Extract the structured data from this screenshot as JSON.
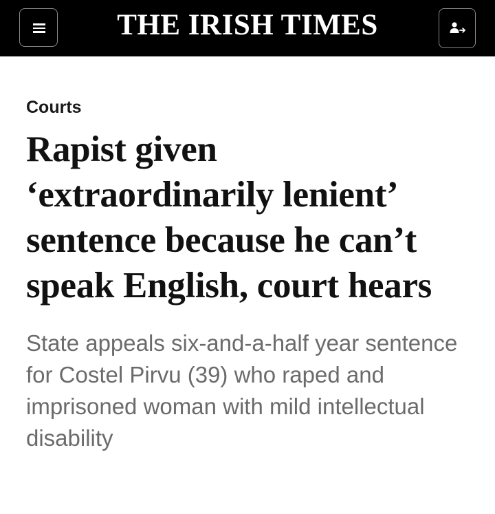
{
  "header": {
    "masthead": "THE IRISH TIMES",
    "menu_icon": "hamburger-menu-icon",
    "account_icon": "account-sign-in-icon",
    "background": "#000000",
    "text_color": "#ffffff"
  },
  "article": {
    "section": "Courts",
    "headline": "Rapist given ‘extraordinarily lenient’ sentence because he can’t speak English, court hears",
    "standfirst": "State appeals six-and-a-half year sentence for Costel Pirvu (39) who raped and imprisoned woman with mild intellectual disability",
    "headline_color": "#111111",
    "standfirst_color": "#6b6b6b"
  }
}
